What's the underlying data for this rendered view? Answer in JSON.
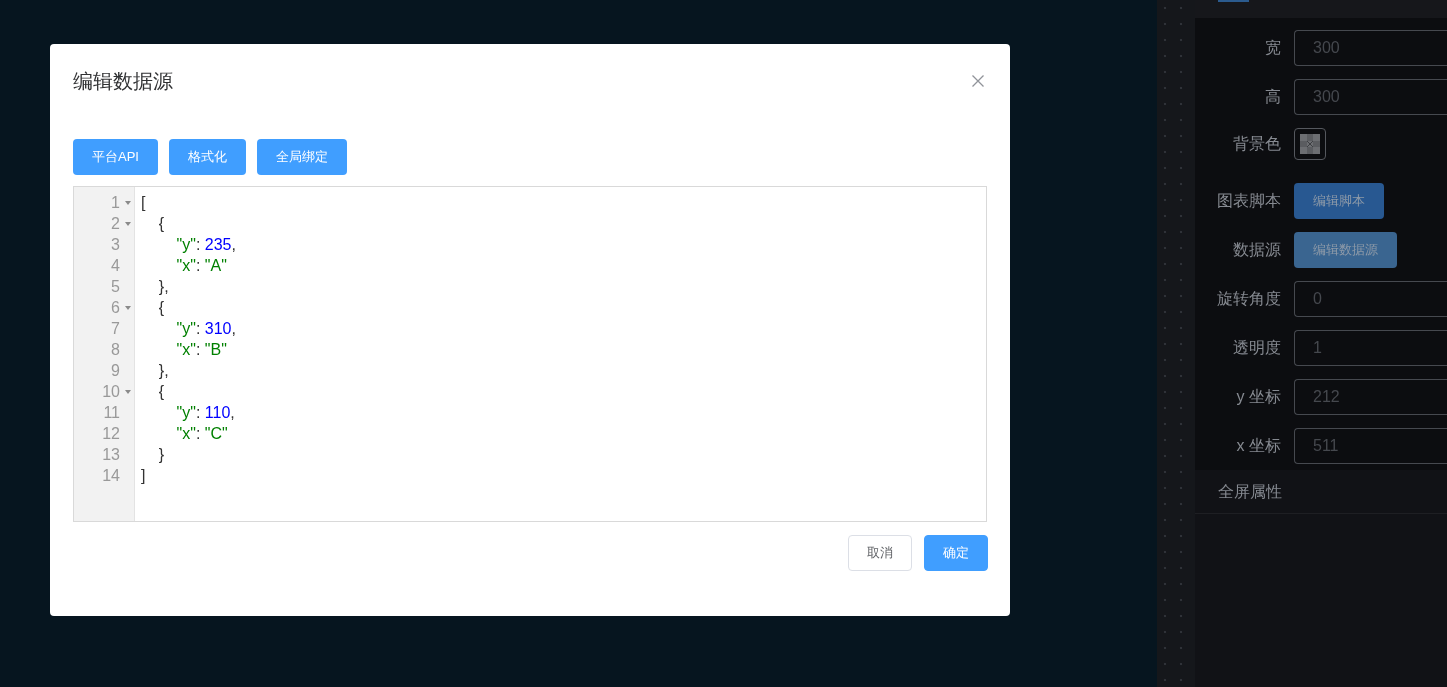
{
  "properties_panel": {
    "tabs": [
      {
        "selected": true
      }
    ],
    "rows": [
      {
        "label": "宽",
        "kind": "input",
        "value": "300"
      },
      {
        "label": "高",
        "kind": "input",
        "value": "300"
      },
      {
        "label": "背景色",
        "kind": "color"
      },
      {
        "label": "图表脚本",
        "kind": "button",
        "button": "编辑脚本",
        "focused": false
      },
      {
        "label": "数据源",
        "kind": "button",
        "button": "编辑数据源",
        "focused": true
      },
      {
        "label": "旋转角度",
        "kind": "input",
        "value": "0"
      },
      {
        "label": "透明度",
        "kind": "input",
        "value": "1"
      },
      {
        "label": "y 坐标",
        "kind": "input",
        "value": "212"
      },
      {
        "label": "x 坐标",
        "kind": "input",
        "value": "511"
      }
    ],
    "sections": [
      {
        "title": "全屏属性"
      }
    ]
  },
  "dialog": {
    "title": "编辑数据源",
    "toolbar": [
      "平台API",
      "格式化",
      "全局绑定"
    ],
    "editor": {
      "lines": [
        {
          "number": "1",
          "foldable": true,
          "tokens": [
            {
              "kind": "punct",
              "text": "["
            }
          ]
        },
        {
          "number": "2",
          "foldable": true,
          "tokens": [
            {
              "kind": "punct",
              "text": "    {"
            }
          ]
        },
        {
          "number": "3",
          "foldable": false,
          "tokens": [
            {
              "kind": "key",
              "text": "        \"y\""
            },
            {
              "kind": "punct",
              "text": ": "
            },
            {
              "kind": "number",
              "text": "235"
            },
            {
              "kind": "punct",
              "text": ","
            }
          ]
        },
        {
          "number": "4",
          "foldable": false,
          "tokens": [
            {
              "kind": "key",
              "text": "        \"x\""
            },
            {
              "kind": "punct",
              "text": ": "
            },
            {
              "kind": "string",
              "text": "\"A\""
            }
          ]
        },
        {
          "number": "5",
          "foldable": false,
          "tokens": [
            {
              "kind": "punct",
              "text": "    },"
            }
          ]
        },
        {
          "number": "6",
          "foldable": true,
          "tokens": [
            {
              "kind": "punct",
              "text": "    {"
            }
          ]
        },
        {
          "number": "7",
          "foldable": false,
          "tokens": [
            {
              "kind": "key",
              "text": "        \"y\""
            },
            {
              "kind": "punct",
              "text": ": "
            },
            {
              "kind": "number",
              "text": "310"
            },
            {
              "kind": "punct",
              "text": ","
            }
          ]
        },
        {
          "number": "8",
          "foldable": false,
          "tokens": [
            {
              "kind": "key",
              "text": "        \"x\""
            },
            {
              "kind": "punct",
              "text": ": "
            },
            {
              "kind": "string",
              "text": "\"B\""
            }
          ]
        },
        {
          "number": "9",
          "foldable": false,
          "tokens": [
            {
              "kind": "punct",
              "text": "    },"
            }
          ]
        },
        {
          "number": "10",
          "foldable": true,
          "tokens": [
            {
              "kind": "punct",
              "text": "    {"
            }
          ]
        },
        {
          "number": "11",
          "foldable": false,
          "tokens": [
            {
              "kind": "key",
              "text": "        \"y\""
            },
            {
              "kind": "punct",
              "text": ": "
            },
            {
              "kind": "number",
              "text": "110"
            },
            {
              "kind": "punct",
              "text": ","
            }
          ]
        },
        {
          "number": "12",
          "foldable": false,
          "tokens": [
            {
              "kind": "key",
              "text": "        \"x\""
            },
            {
              "kind": "punct",
              "text": ": "
            },
            {
              "kind": "string",
              "text": "\"C\""
            }
          ]
        },
        {
          "number": "13",
          "foldable": false,
          "tokens": [
            {
              "kind": "punct",
              "text": "    }"
            }
          ]
        },
        {
          "number": "14",
          "foldable": false,
          "tokens": [
            {
              "kind": "punct",
              "text": "]"
            }
          ]
        }
      ]
    },
    "footer": [
      {
        "label": "取消",
        "kind": "default"
      },
      {
        "label": "确定",
        "kind": "primary"
      }
    ]
  }
}
